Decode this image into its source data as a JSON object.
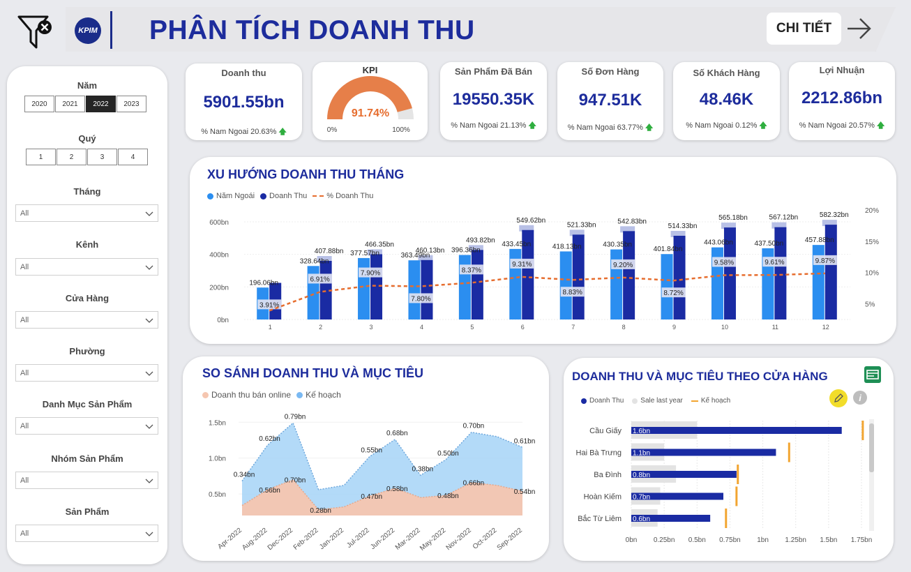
{
  "header": {
    "title": "PHÂN TÍCH DOANH THU",
    "logo_text": "KPIM",
    "detail_button": "CHI TIẾT"
  },
  "sidebar": {
    "year_label": "Năm",
    "years": [
      "2020",
      "2021",
      "2022",
      "2023"
    ],
    "active_year": "2022",
    "quarter_label": "Quý",
    "quarters": [
      "1",
      "2",
      "3",
      "4"
    ],
    "filters": [
      {
        "label": "Tháng",
        "value": "All"
      },
      {
        "label": "Kênh",
        "value": "All"
      },
      {
        "label": "Cửa Hàng",
        "value": "All"
      },
      {
        "label": "Phường",
        "value": "All"
      },
      {
        "label": "Danh Mục Sản Phẩm",
        "value": "All"
      },
      {
        "label": "Nhóm Sản Phẩm",
        "value": "All"
      },
      {
        "label": "Sản Phẩm",
        "value": "All"
      }
    ]
  },
  "kpis": {
    "revenue": {
      "title": "Doanh thu",
      "value": "5901.55bn",
      "sub": "% Nam Ngoai 20.63%"
    },
    "kpi": {
      "title": "KPI",
      "value": "91.74%",
      "min": "0%",
      "max": "100%",
      "fraction": 0.9174
    },
    "products": {
      "title": "Sản Phẩm Đã Bán",
      "value": "19550.35K",
      "sub": "% Nam Ngoai 21.13%"
    },
    "orders": {
      "title": "Số Đơn Hàng",
      "value": "947.51K",
      "sub": "% Nam Ngoai 63.77%"
    },
    "customers": {
      "title": "Số Khách Hàng",
      "value": "48.46K",
      "sub": "% Nam Ngoai 0.12%"
    },
    "profit": {
      "title": "Lợi Nhuận",
      "value": "2212.86bn",
      "sub": "% Nam Ngoai 20.57%"
    }
  },
  "colors": {
    "prev_year": "#2b8ef0",
    "revenue": "#1a2ba3",
    "pct_line": "#e66d2e",
    "online": "#f5c6b0",
    "plan": "#a6d3f7",
    "sale_last_year": "#e3e3e3",
    "target": "#f2a531"
  },
  "chart_data": [
    {
      "type": "bar",
      "title": "XU HƯỚNG DOANH THU THÁNG",
      "legend": [
        "Năm Ngoái",
        "Doanh Thu",
        "% Doanh Thu"
      ],
      "categories": [
        "1",
        "2",
        "3",
        "4",
        "5",
        "6",
        "7",
        "8",
        "9",
        "10",
        "11",
        "12"
      ],
      "series": [
        {
          "name": "Năm Ngoái",
          "values": [
            196.06,
            328.64,
            377.57,
            363.49,
            396.36,
            433.45,
            418.13,
            430.35,
            401.84,
            443.06,
            437.5,
            457.88
          ]
        },
        {
          "name": "Doanh Thu",
          "values": [
            225,
            360,
            401,
            365,
            427,
            549.62,
            521.33,
            542.83,
            514.33,
            565.18,
            567.12,
            582.32
          ]
        },
        {
          "name": "% Doanh Thu",
          "values": [
            3.91,
            6.91,
            7.9,
            7.8,
            8.37,
            9.31,
            8.83,
            9.2,
            8.72,
            9.58,
            9.61,
            9.87
          ]
        }
      ],
      "labels_prev": [
        "196.06bn",
        "328.64bn",
        "377.57bn",
        "363.49bn",
        "396.36bn",
        "433.45bn",
        "418.13bn",
        "430.35bn",
        "401.84bn",
        "443.06bn",
        "437.50bn",
        "457.88bn"
      ],
      "labels_top": [
        "",
        "407.88bn",
        "466.35bn",
        "460.13bn",
        "493.82bn",
        "549.62bn",
        "521.33bn",
        "542.83bn",
        "514.33bn",
        "565.18bn",
        "567.12bn",
        "582.32bn"
      ],
      "labels_pct": [
        "3.91%",
        "6.91%",
        "7.90%",
        "7.80%",
        "8.37%",
        "9.31%",
        "8.83%",
        "9.20%",
        "8.72%",
        "9.58%",
        "9.61%",
        "9.87%"
      ],
      "y_ticks": [
        "0bn",
        "200bn",
        "400bn",
        "600bn"
      ],
      "y2_ticks": [
        "5%",
        "10%",
        "15%",
        "20%"
      ],
      "ylim": [
        0,
        600
      ],
      "y2lim": [
        2.5,
        20
      ]
    },
    {
      "type": "area",
      "title": "SO SÁNH DOANH THU VÀ MỤC TIÊU",
      "legend": [
        "Doanh thu bán online",
        "Kế hoạch"
      ],
      "categories": [
        "Apr-2022",
        "Aug-2022",
        "Dec-2022",
        "Feb-2022",
        "Jan-2022",
        "Jul-2022",
        "Jun-2022",
        "Mar-2022",
        "May-2022",
        "Nov-2022",
        "Oct-2022",
        "Sep-2022"
      ],
      "series": [
        {
          "name": "Doanh thu bán online",
          "values": [
            0.34,
            0.56,
            0.7,
            0.28,
            0.32,
            0.47,
            0.58,
            0.45,
            0.48,
            0.66,
            0.62,
            0.54
          ]
        },
        {
          "name": "Kế hoạch",
          "values": [
            0.68,
            1.18,
            1.49,
            0.56,
            0.62,
            1.02,
            1.26,
            0.76,
            0.98,
            1.36,
            1.3,
            1.15
          ]
        }
      ],
      "labels_online": [
        "",
        "0.56bn",
        "0.70bn",
        "0.28bn",
        "",
        "0.47bn",
        "0.58bn",
        "",
        "0.48bn",
        "0.66bn",
        "",
        "0.54bn"
      ],
      "labels_plan": [
        "0.34bn",
        "0.62bn",
        "0.79bn",
        "",
        "",
        "0.55bn",
        "0.68bn",
        "0.38bn",
        "0.50bn",
        "0.70bn",
        "",
        "0.61bn"
      ],
      "y_ticks": [
        "0.5bn",
        "1.0bn",
        "1.5bn"
      ],
      "ylim": [
        0.2,
        1.6
      ]
    },
    {
      "type": "bar",
      "title": "DOANH THU VÀ MỤC TIÊU THEO CỬA HÀNG",
      "legend": [
        "Doanh Thu",
        "Sale last year",
        "Kế hoạch"
      ],
      "categories": [
        "Cầu Giấy",
        "Hai Bà Trưng",
        "Ba Đình",
        "Hoàn Kiếm",
        "Bắc Từ Liêm"
      ],
      "series": [
        {
          "name": "Doanh Thu",
          "values": [
            1.6,
            1.1,
            0.8,
            0.7,
            0.6
          ]
        },
        {
          "name": "Sale last year",
          "values": [
            0.5,
            0.25,
            0.34,
            0.22,
            0.2
          ]
        },
        {
          "name": "Kế hoạch",
          "values": [
            1.76,
            1.2,
            0.81,
            0.8,
            0.72
          ]
        }
      ],
      "labels": [
        "1.6bn",
        "1.1bn",
        "0.8bn",
        "0.7bn",
        "0.6bn"
      ],
      "x_ticks": [
        "0bn",
        "0.25bn",
        "0.5bn",
        "0.75bn",
        "1bn",
        "1.25bn",
        "1.5bn",
        "1.75bn"
      ],
      "xlim": [
        0,
        1.75
      ]
    }
  ]
}
